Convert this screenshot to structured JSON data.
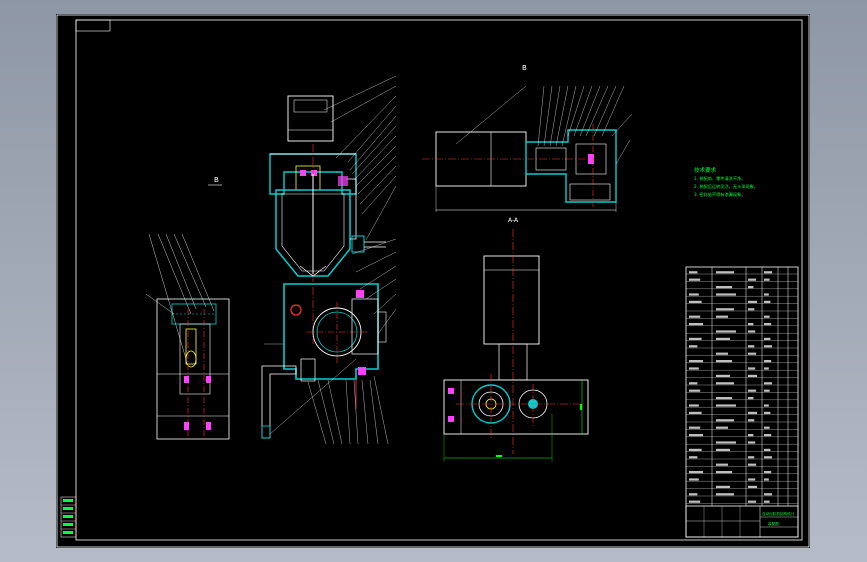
{
  "drawing": {
    "view_labels": {
      "left_view": "B",
      "top_view": "B",
      "section_view": "A-A"
    },
    "tech_notes": {
      "title": "技术要求",
      "lines": [
        "1. 装配前，零件清洗干净。",
        "2. 装配后运转灵活，无卡滞现象。",
        "3. 密封处不得有渗漏现象。"
      ]
    },
    "title_block": {
      "name_line1": "自动点胶机结构设计",
      "name_line2": "装配图"
    }
  },
  "colors": {
    "background": "#000000",
    "outline": "#ffffff",
    "hatch": "#00d0d0",
    "center_line": "#ff3030",
    "dimension": "#00ff00",
    "notes": "#00ff40",
    "part_yellow": "#ffff40",
    "magenta": "#ff40ff"
  }
}
